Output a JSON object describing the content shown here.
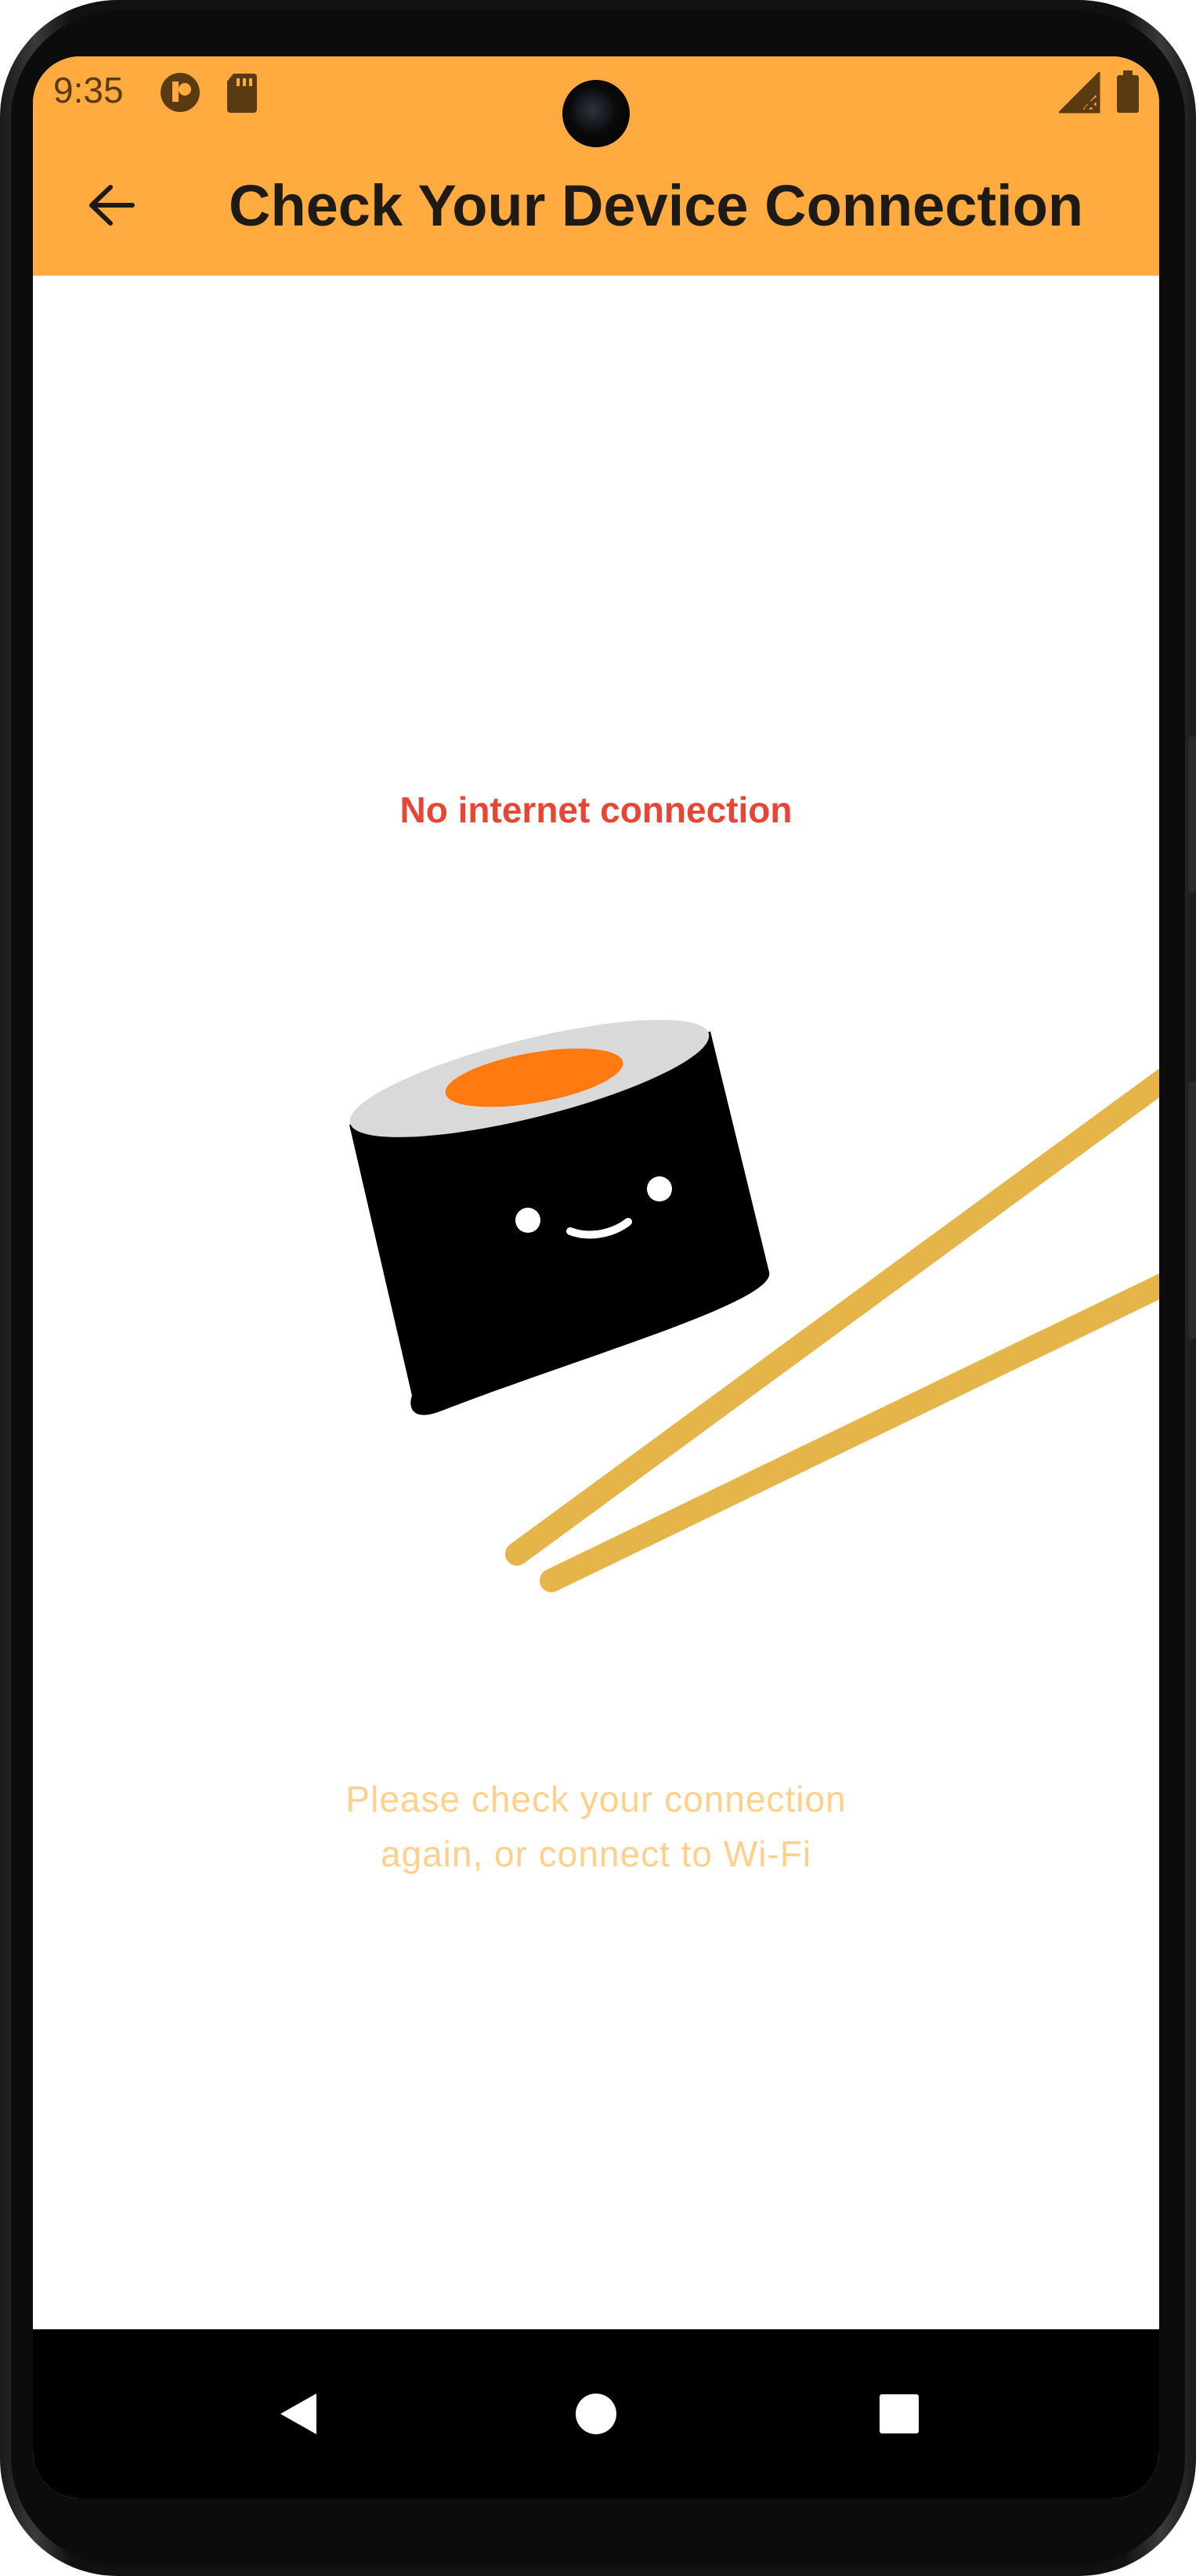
{
  "status_bar": {
    "time": "9:35",
    "icons": [
      "app-notification-icon",
      "sd-card-icon",
      "signal-off-icon",
      "battery-icon"
    ]
  },
  "app_bar": {
    "back_icon": "arrow-left-icon",
    "title": "Check Your Device Connection"
  },
  "content": {
    "error_title": "No internet connection",
    "message_line_1": "Please check your connection",
    "message_line_2": "again, or connect to Wi-Fi",
    "illustration": "sushi-with-chopsticks"
  },
  "nav_bar": {
    "buttons": [
      "back-triangle-icon",
      "home-circle-icon",
      "recents-square-icon"
    ]
  },
  "colors": {
    "app_bar": "#FFAB40",
    "error_title": "#E94535",
    "message": "#FFD089",
    "chopsticks": "#E6B54A",
    "salmon": "#FF7A10",
    "rice": "#D9D9D9"
  }
}
